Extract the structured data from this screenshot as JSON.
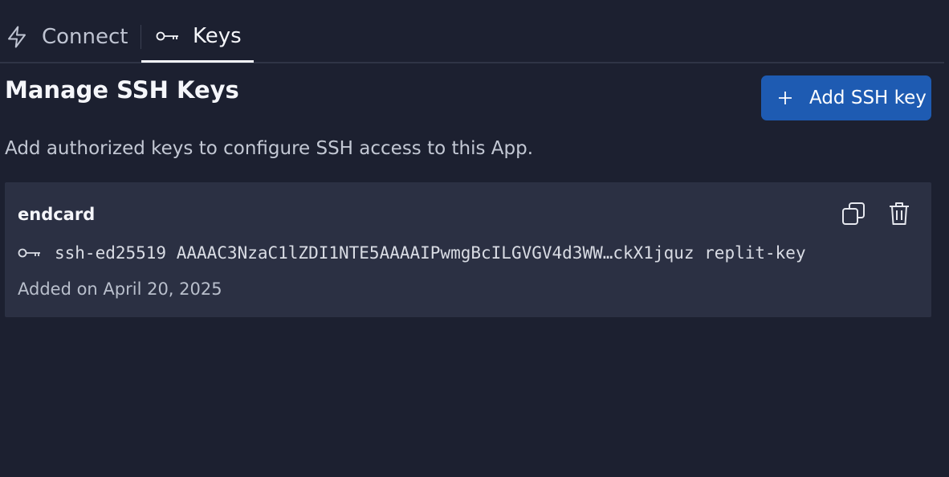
{
  "tabs": [
    {
      "label": "Connect",
      "icon": "lightning-icon",
      "active": false
    },
    {
      "label": "Keys",
      "icon": "key-icon",
      "active": true
    }
  ],
  "page": {
    "title": "Manage SSH Keys",
    "description": "Add authorized keys to configure SSH access to this App.",
    "add_button": {
      "label": "Add SSH key",
      "icon": "plus-icon"
    }
  },
  "keys": [
    {
      "name": "endcard",
      "public_key": "ssh-ed25519 AAAAC3NzaC1lZDI1NTE5AAAAIPwmgBcILGVGV4d3WW…ckX1jquz replit-key",
      "added_on": "Added on April 20, 2025",
      "actions": [
        "copy-icon",
        "trash-icon"
      ]
    }
  ],
  "colors": {
    "background": "#1c2030",
    "card": "#2b3043",
    "accent": "#1e5bb2"
  }
}
